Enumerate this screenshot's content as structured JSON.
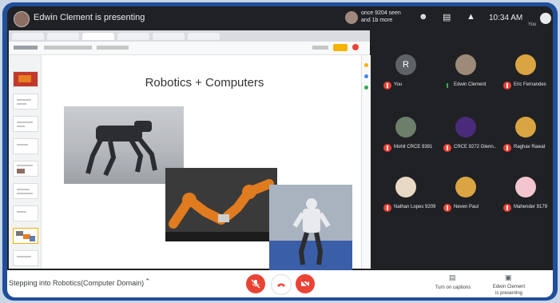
{
  "topbar": {
    "presenter_status": "Edwin Clement is presenting",
    "participants_line1": "once 9204 seen",
    "participants_line2": "and 1b more",
    "time": "10:34 AM",
    "you_label": "You"
  },
  "slide": {
    "title": "Robotics + Computers"
  },
  "participants": [
    {
      "name": "You",
      "initial": "R",
      "avatar_color": "#5f6368",
      "muted": true
    },
    {
      "name": "Edwin Clement",
      "initial": "",
      "avatar_color": "#9e8a78",
      "muted": false
    },
    {
      "name": "Eric Fernandes",
      "initial": "",
      "avatar_color": "#d9a441",
      "muted": true
    },
    {
      "name": "Mohit CRCE 9391",
      "initial": "",
      "avatar_color": "#6d7f6a",
      "muted": true
    },
    {
      "name": "CRCE 9272 Glenn..",
      "initial": "",
      "avatar_color": "#4a2a7a",
      "muted": true
    },
    {
      "name": "Raghav Rawat",
      "initial": "",
      "avatar_color": "#d9a441",
      "muted": true
    },
    {
      "name": "Nathan Lopes 9209",
      "initial": "",
      "avatar_color": "#e8d9c4",
      "muted": true
    },
    {
      "name": "Neven Paul",
      "initial": "",
      "avatar_color": "#d9a441",
      "muted": true
    },
    {
      "name": "Mahender 9179",
      "initial": "",
      "avatar_color": "#f3c6cf",
      "muted": true
    }
  ],
  "bottombar": {
    "meeting_title": "Stepping into Robotics(Computer Domain)",
    "captions_label": "Turn on captions",
    "presenting_line1": "Edwin Clement",
    "presenting_line2": "is presenting"
  },
  "colors": {
    "frame": "#1f4f9a",
    "meet_bg": "#202124",
    "red": "#ea4335",
    "accent_yellow": "#f4b400"
  }
}
